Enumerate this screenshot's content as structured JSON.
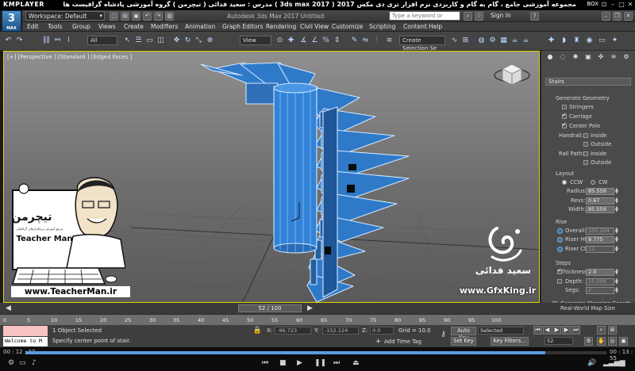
{
  "player": {
    "name": "KMPLAYER",
    "title_rtl": "مجموعه آموزشی جامع ، گام به گام و کاربردی نرم افزار تری دی مکس 2017  ( 3ds max 2017 )   مدرس : سعید فدائی ( تیچرمن ) گروه آموزشی پادشاه گرافیست ها",
    "box_label": "BOX",
    "time_elapsed": "00 : 12 : 27",
    "time_total": "00 : 13 : 55",
    "progress": 0.895
  },
  "max": {
    "logo": "3",
    "logo_sub": "MAX",
    "workspace": "Workspace: Default",
    "app_title": "Autodesk 3ds Max 2017      Untitled",
    "search_placeholder": "Type a keyword or phrase",
    "sign_in": "Sign In"
  },
  "menu": [
    "Edit",
    "Tools",
    "Group",
    "Views",
    "Create",
    "Modifiers",
    "Animation",
    "Graph Editors",
    "Rendering",
    "Civil View",
    "Customize",
    "Scripting",
    "Content",
    "Help"
  ],
  "toolbar": {
    "filter": "All",
    "ref_coord": "View",
    "selection_set": "Create Selection Se"
  },
  "viewport": {
    "label": "[+] [Perspective ] [Standard ] [Edged Faces ]"
  },
  "command_panel": {
    "object_type": "Stairs",
    "generate_geometry": "Generate Geometry",
    "stringers": "Stringers",
    "carriage": "Carriage",
    "center_pole": "Center Pole",
    "handrail": "Handrail:",
    "rail_path": "Rail Path:",
    "inside": "Inside",
    "outside": "Outside",
    "layout": "Layout",
    "ccw": "CCW",
    "cw": "CW",
    "radius_label": "Radius:",
    "radius": "85.559",
    "revs_label": "Revs:",
    "revs": "0.67",
    "width_label": "Width:",
    "width": "85.559",
    "rise": "Rise",
    "overall_label": "Overall:",
    "overall": "105.294",
    "riser_ht_label": "Riser Ht:",
    "riser_ht": "8.775",
    "riser_ct_label": "Riser Ct:",
    "riser_ct": "12",
    "steps": "Steps",
    "thickness_label": "Thickness:",
    "thickness": "2.0",
    "depth_label": "Depth:",
    "depth": "15.008",
    "segs_label": "Segs:",
    "segs": "2",
    "gen_mapping": "Generate Mapping Coords.",
    "real_world": "Real-World Map Size"
  },
  "timeline": {
    "slider": "52 / 100",
    "ticks": [
      "0",
      "5",
      "10",
      "15",
      "20",
      "25",
      "30",
      "35",
      "40",
      "45",
      "50",
      "55",
      "60",
      "65",
      "70",
      "75",
      "80",
      "85",
      "90",
      "95",
      "100"
    ]
  },
  "status": {
    "welcome": "Welcome to M",
    "selected": "1 Object Selected",
    "prompt": "Specify center point of stair.",
    "x_label": "X:",
    "x": "-96.723",
    "y_label": "Y:",
    "y": "-152.124",
    "z_label": "Z:",
    "z": "0.0",
    "grid": "Grid = 10.0",
    "add_time_tag": "Add Time Tag",
    "auto_key": "Auto Key",
    "set_key": "Set Key",
    "selected_dd": "Selected",
    "key_filters": "Key Filters...",
    "frame": "52"
  },
  "overlays": {
    "teacher_logo": "تیچرمن",
    "teacher_sub": "مرجع آموزش نرم‌افزارهای گرافیکی",
    "teacher_en": "Teacher Man",
    "teacher_url": "www.TeacherMan.ir",
    "gfx_name": "سعید فدائی",
    "gfx_url": "www.GfxKing.ir"
  },
  "colors": {
    "stair_fill": "#2f79c9",
    "stair_edge": "#cfe7ff",
    "viewport_border": "#e5d200",
    "max_blue": "#1d4f86"
  }
}
